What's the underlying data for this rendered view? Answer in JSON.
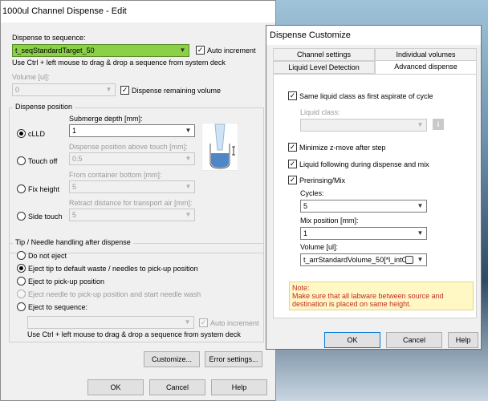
{
  "main": {
    "title": "1000ul Channel Dispense - Edit",
    "sequence_label": "Dispense to sequence:",
    "sequence_value": "t_seqStandardTarget_50",
    "auto_increment": "Auto increment",
    "drag_hint": "Use Ctrl + left mouse to drag & drop a sequence from system deck",
    "volume_label": "Volume [ul]:",
    "volume_value": "0",
    "dispense_remaining": "Dispense remaining volume",
    "dispense_position": {
      "legend": "Dispense position",
      "options": [
        "cLLD",
        "Touch off",
        "Fix height",
        "Side touch"
      ],
      "submerge_label": "Submerge depth [mm]:",
      "submerge_value": "1",
      "above_touch_label": "Dispense position above touch [mm]:",
      "above_touch_value": "0.5",
      "container_bottom_label": "From container bottom [mm]:",
      "container_bottom_value": "5",
      "retract_label": "Retract distance for transport air [mm]:",
      "retract_value": "5"
    },
    "tip_handling": {
      "legend": "Tip / Needle handling after dispense",
      "options": [
        "Do not eject",
        "Eject tip to default waste / needles to pick-up position",
        "Eject to pick-up position",
        "Eject needle to pick-up position and start needle wash",
        "Eject to sequence:"
      ],
      "auto_increment": "Auto increment",
      "drag_hint": "Use Ctrl + left mouse to drag & drop a sequence from system deck"
    },
    "buttons": {
      "customize": "Customize...",
      "error_settings": "Error settings...",
      "ok": "OK",
      "cancel": "Cancel",
      "help": "Help"
    }
  },
  "dialog": {
    "title": "Dispense Customize",
    "tabs": [
      "Channel settings",
      "Individual volumes",
      "Liquid Level Detection",
      "Advanced dispense"
    ],
    "same_liquid_class": "Same liquid class as first aspirate of cycle",
    "liquid_class_label": "Liquid class:",
    "minimize_z": "Minimize z-move after step",
    "liquid_following": "Liquid following during dispense and mix",
    "prerinsing": "Prerinsing/Mix",
    "cycles_label": "Cycles:",
    "cycles_value": "5",
    "mix_position_label": "Mix position [mm]:",
    "mix_position_value": "1",
    "volume_label": "Volume [ul]:",
    "volume_value": "t_arrStandardVolume_50[*l_intC",
    "note_title": "Note:",
    "note_text": "Make sure that all labware between source and destination is placed on same height.",
    "buttons": {
      "ok": "OK",
      "cancel": "Cancel",
      "help": "Help"
    }
  },
  "icons": {
    "check": "✓",
    "arrow": "▼",
    "info": "i"
  }
}
